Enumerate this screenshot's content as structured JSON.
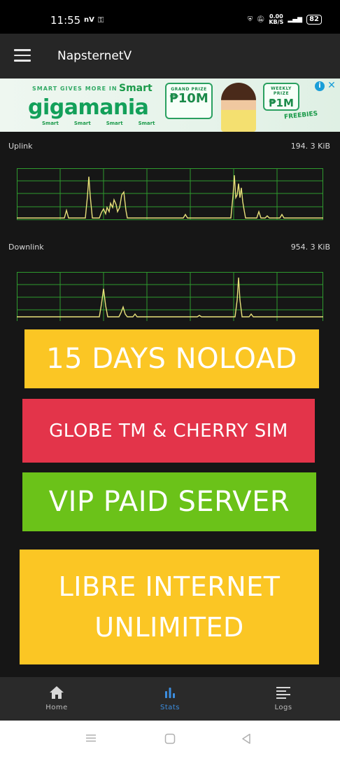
{
  "statusbar": {
    "time": "11:55",
    "carrier": "nV",
    "speed_value": "0.00",
    "speed_unit": "KB/S",
    "battery": "82"
  },
  "appbar": {
    "title": "NapsternetV"
  },
  "ad": {
    "tagline": "SMART GIVES MORE IN",
    "brand": "Smart",
    "headline": "gigamania",
    "prize1_label": "GRAND PRIZE",
    "prize1_amount": "₱10M",
    "prize2_label": "WEEKLY PRIZE",
    "prize2_amount": "₱1M",
    "freebies": "FREEBIES",
    "brands": [
      "Smart",
      "Smart",
      "Smart",
      "Smart"
    ]
  },
  "stats": {
    "uplink_label": "Uplink",
    "uplink_value": "194. 3 KiB",
    "downlink_label": "Downlink",
    "downlink_value": "954. 3 KiB"
  },
  "banners": {
    "b1": "15 DAYS NOLOAD",
    "b2": "GLOBE TM & CHERRY SIM",
    "b3": "VIP PAID SERVER",
    "b4_line1": "LIBRE INTERNET",
    "b4_line2": "UNLIMITED"
  },
  "bottomnav": {
    "home": "Home",
    "stats": "Stats",
    "logs": "Logs"
  },
  "colors": {
    "graph_line": "#e8e07a",
    "graph_grid": "#2e9a2e",
    "accent": "#3c8ee0"
  }
}
